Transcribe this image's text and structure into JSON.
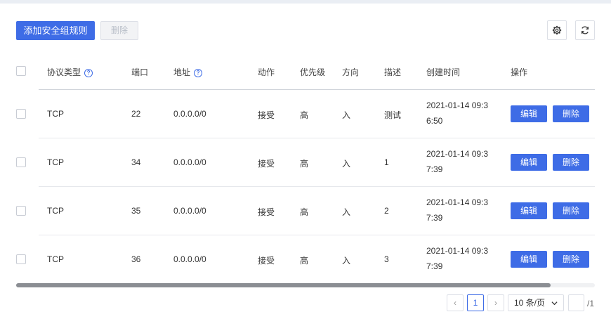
{
  "toolbar": {
    "add_label": "添加安全组规则",
    "delete_label": "删除",
    "settings_icon": "gear-icon",
    "refresh_icon": "refresh-icon"
  },
  "table": {
    "headers": {
      "protocol": "协议类型",
      "port": "端口",
      "address": "地址",
      "action": "动作",
      "priority": "优先级",
      "direction": "方向",
      "description": "描述",
      "created": "创建时间",
      "operation": "操作"
    },
    "help_glyph": "?",
    "rows": [
      {
        "protocol": "TCP",
        "port": "22",
        "address": "0.0.0.0/0",
        "action": "接受",
        "priority": "高",
        "direction": "入",
        "description": "测试",
        "created_1": "2021-01-14 09:3",
        "created_2": "6:50",
        "edit": "编辑",
        "delete": "删除"
      },
      {
        "protocol": "TCP",
        "port": "34",
        "address": "0.0.0.0/0",
        "action": "接受",
        "priority": "高",
        "direction": "入",
        "description": "1",
        "created_1": "2021-01-14 09:3",
        "created_2": "7:39",
        "edit": "编辑",
        "delete": "删除"
      },
      {
        "protocol": "TCP",
        "port": "35",
        "address": "0.0.0.0/0",
        "action": "接受",
        "priority": "高",
        "direction": "入",
        "description": "2",
        "created_1": "2021-01-14 09:3",
        "created_2": "7:39",
        "edit": "编辑",
        "delete": "删除"
      },
      {
        "protocol": "TCP",
        "port": "36",
        "address": "0.0.0.0/0",
        "action": "接受",
        "priority": "高",
        "direction": "入",
        "description": "3",
        "created_1": "2021-01-14 09:3",
        "created_2": "7:39",
        "edit": "编辑",
        "delete": "删除"
      }
    ]
  },
  "pagination": {
    "prev": "‹",
    "current_page": "1",
    "next": "›",
    "page_size": "10 条/页",
    "jump_value": "",
    "total_pages": "/1"
  },
  "colors": {
    "primary": "#3e6ce6",
    "border": "#dcdfe6"
  }
}
